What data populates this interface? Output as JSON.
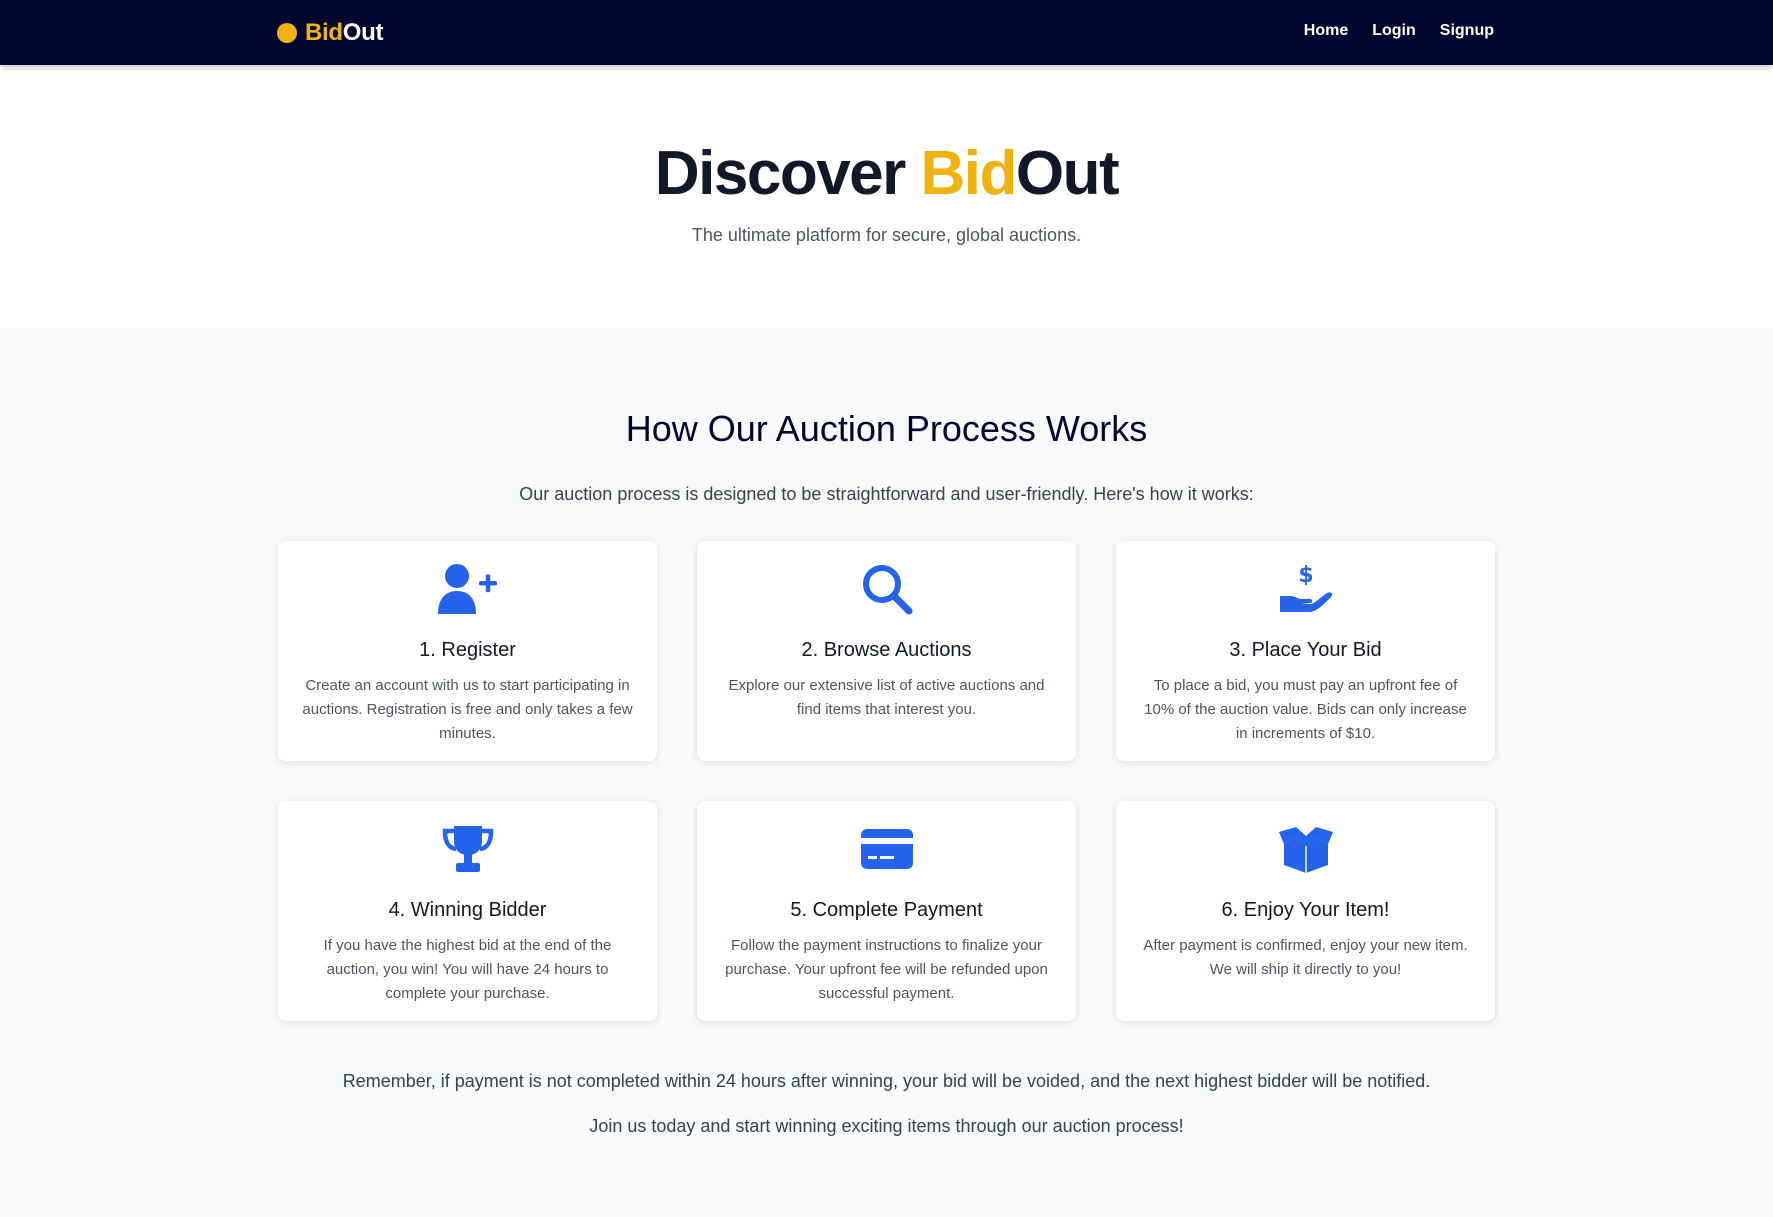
{
  "nav": {
    "brand_bid": "Bid",
    "brand_out": "Out",
    "links": [
      "Home",
      "Login",
      "Signup"
    ]
  },
  "hero": {
    "title_prefix": "Discover ",
    "title_bid": "Bid",
    "title_out": "Out",
    "subtitle": "The ultimate platform for secure, global auctions."
  },
  "process": {
    "title": "How Our Auction Process Works",
    "intro": "Our auction process is designed to be straightforward and user-friendly. Here's how it works:",
    "steps": [
      {
        "icon": "user-plus-icon",
        "title": "1. Register",
        "text": "Create an account with us to start participating in auctions. Registration is free and only takes a few minutes."
      },
      {
        "icon": "search-icon",
        "title": "2. Browse Auctions",
        "text": "Explore our extensive list of active auctions and find items that interest you."
      },
      {
        "icon": "hand-dollar-icon",
        "title": "3. Place Your Bid",
        "text": "To place a bid, you must pay an upfront fee of 10% of the auction value. Bids can only increase in increments of $10."
      },
      {
        "icon": "trophy-icon",
        "title": "4. Winning Bidder",
        "text": "If you have the highest bid at the end of the auction, you win! You will have 24 hours to complete your purchase."
      },
      {
        "icon": "credit-card-icon",
        "title": "5. Complete Payment",
        "text": "Follow the payment instructions to finalize your purchase. Your upfront fee will be refunded upon successful payment."
      },
      {
        "icon": "open-box-icon",
        "title": "6. Enjoy Your Item!",
        "text": "After payment is confirmed, enjoy your new item. We will ship it directly to you!"
      }
    ],
    "note_1": "Remember, if payment is not completed within 24 hours after winning, your bid will be voided, and the next highest bidder will be notified.",
    "note_2": "Join us today and start winning exciting items through our auction process!"
  },
  "colors": {
    "nav_bg": "#04052e",
    "accent": "#f0b20e",
    "icon_blue": "#2563eb"
  }
}
